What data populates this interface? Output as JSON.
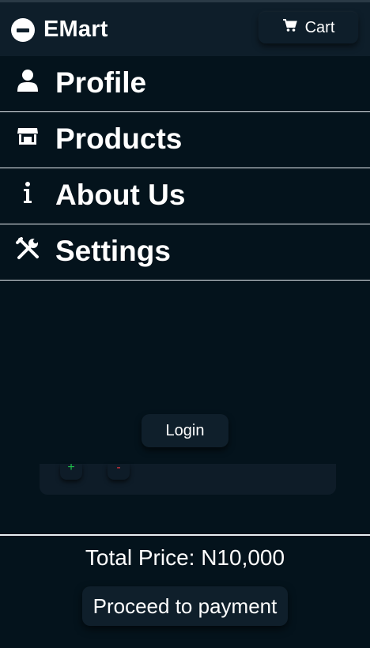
{
  "app": {
    "name": "EMart"
  },
  "header": {
    "cart_label": "Cart"
  },
  "menu": {
    "items": [
      {
        "label": "Profile",
        "icon": "user-icon"
      },
      {
        "label": "Products",
        "icon": "store-icon"
      },
      {
        "label": "About Us",
        "icon": "info-icon"
      },
      {
        "label": "Settings",
        "icon": "tools-icon"
      }
    ]
  },
  "login": {
    "label": "Login"
  },
  "cart_item": {
    "increase_label": "+",
    "decrease_label": "-"
  },
  "footer": {
    "total_text": "Total Price: N10,000",
    "pay_label": "Proceed to payment"
  },
  "colors": {
    "background": "#04131c",
    "header": "#0e1e2a",
    "button": "#0f1f2b",
    "plus": "#1fbf4a",
    "minus": "#e0363d",
    "text": "#ffffff"
  }
}
